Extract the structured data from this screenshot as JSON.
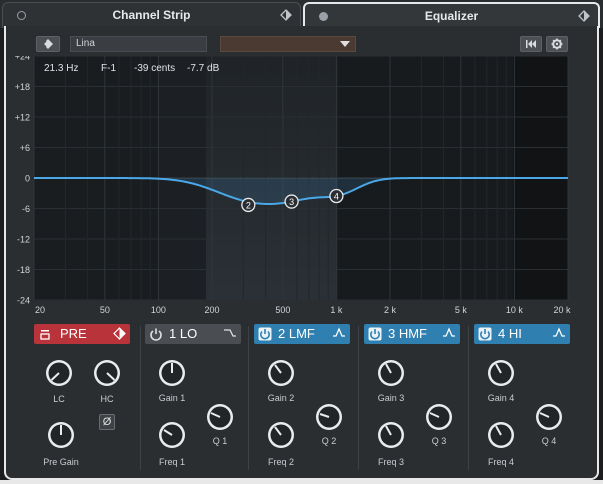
{
  "tabs": [
    {
      "label": "Channel Strip",
      "active": false
    },
    {
      "label": "Equalizer",
      "active": true
    }
  ],
  "toolbar": {
    "preset_name": "Lina"
  },
  "readout": {
    "frequency": "21.3 Hz",
    "note": "F-1",
    "cents": "-39 cents",
    "gain": "-7.7 dB"
  },
  "graph": {
    "y_ticks": [
      "+24",
      "+18",
      "+12",
      "+6",
      "0",
      "-6",
      "-12",
      "-18",
      "-24"
    ],
    "x_ticks": [
      "20",
      "50",
      "100",
      "200",
      "500",
      "1 k",
      "2 k",
      "5 k",
      "10 k",
      "20 k"
    ],
    "nodes": [
      "2",
      "3",
      "4"
    ],
    "curve_color": "#4aa8e8"
  },
  "pre": {
    "title": "PRE",
    "lc_label": "LC",
    "hc_label": "HC",
    "pregain_label": "Pre Gain",
    "phase_symbol": "Ø",
    "color": "#b8333a"
  },
  "bands": [
    {
      "label": "1 LO",
      "gain_label": "Gain 1",
      "q_label": "Q 1",
      "freq_label": "Freq 1",
      "enabled": false
    },
    {
      "label": "2 LMF",
      "gain_label": "Gain 2",
      "q_label": "Q 2",
      "freq_label": "Freq 2",
      "enabled": true
    },
    {
      "label": "3 HMF",
      "gain_label": "Gain 3",
      "q_label": "Q 3",
      "freq_label": "Freq 3",
      "enabled": true
    },
    {
      "label": "4 HI",
      "gain_label": "Gain 4",
      "q_label": "Q 4",
      "freq_label": "Freq 4",
      "enabled": true
    }
  ],
  "colors": {
    "band_on": "#2f7fb0",
    "band_off": "#4a4e52",
    "accent": "#4aa8e8"
  }
}
